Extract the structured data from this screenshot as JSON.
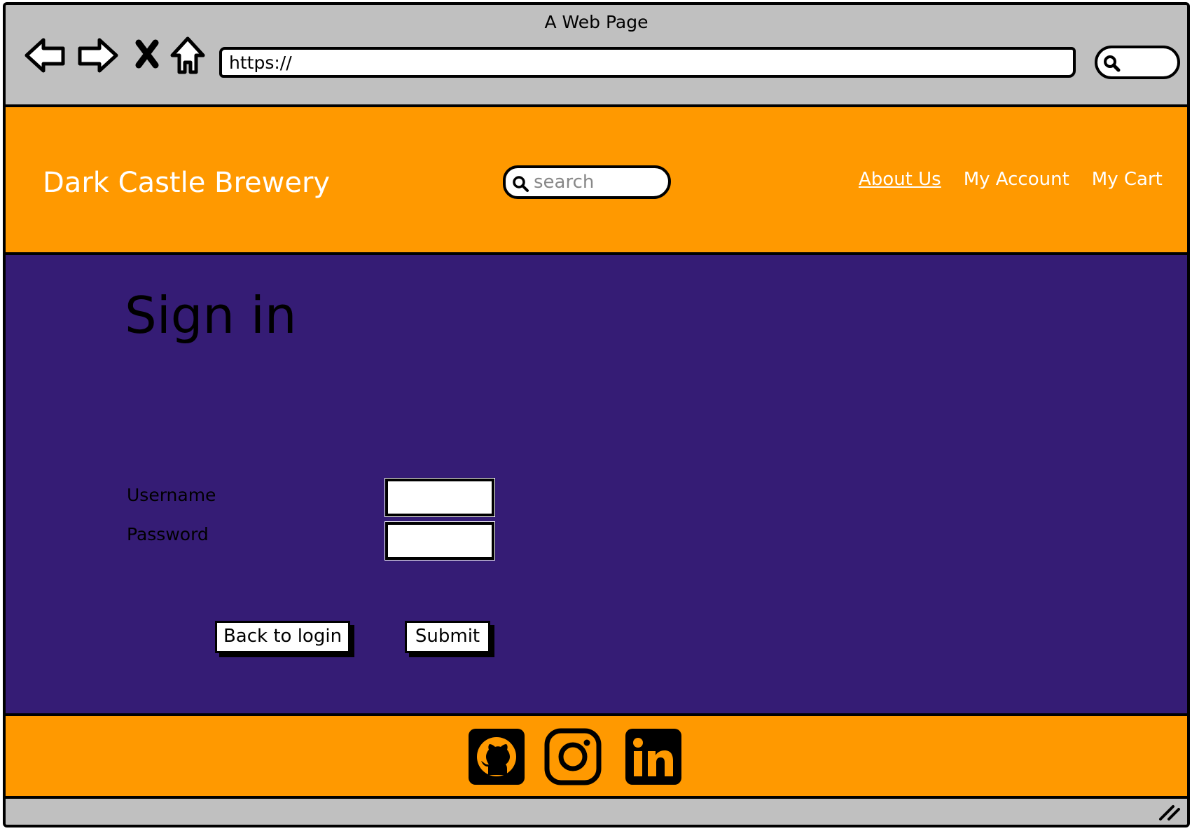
{
  "browser": {
    "title": "A Web Page",
    "url": "https://",
    "icons": [
      "back-arrow-icon",
      "forward-arrow-icon",
      "close-icon",
      "home-icon",
      "search-icon"
    ]
  },
  "header": {
    "brand": "Dark Castle Brewery",
    "search_placeholder": "search",
    "nav": [
      {
        "label": "About Us",
        "active": true
      },
      {
        "label": "My Account",
        "active": false
      },
      {
        "label": "My Cart",
        "active": false
      }
    ]
  },
  "main": {
    "title": "Sign in",
    "username_label": "Username",
    "password_label": "Password",
    "username_value": "",
    "password_value": "",
    "back_button": "Back to login",
    "submit_button": "Submit"
  },
  "footer": {
    "social": [
      "github-icon",
      "instagram-icon",
      "linkedin-icon"
    ]
  },
  "colors": {
    "chrome": "#c0c0c0",
    "accent": "#ff9900",
    "main_bg": "#351c75"
  }
}
